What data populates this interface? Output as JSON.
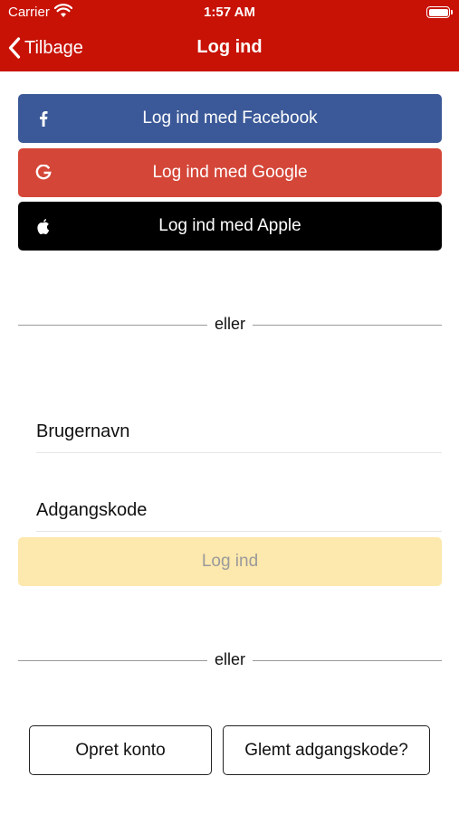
{
  "status_bar": {
    "carrier": "Carrier",
    "time": "1:57 AM"
  },
  "nav": {
    "back_label": "Tilbage",
    "title": "Log ind"
  },
  "social": {
    "facebook_label": "Log ind med Facebook",
    "google_label": "Log ind med Google",
    "apple_label": "Log ind med Apple"
  },
  "divider_text": "eller",
  "form": {
    "username_placeholder": "Brugernavn",
    "password_placeholder": "Adgangskode",
    "submit_label": "Log ind"
  },
  "footer": {
    "create_account_label": "Opret konto",
    "forgot_password_label": "Glemt adgangskode?"
  },
  "colors": {
    "brand_red": "#c81205",
    "facebook": "#3b5998",
    "google": "#d44638",
    "apple": "#000000",
    "login_disabled": "#fde8ad"
  }
}
